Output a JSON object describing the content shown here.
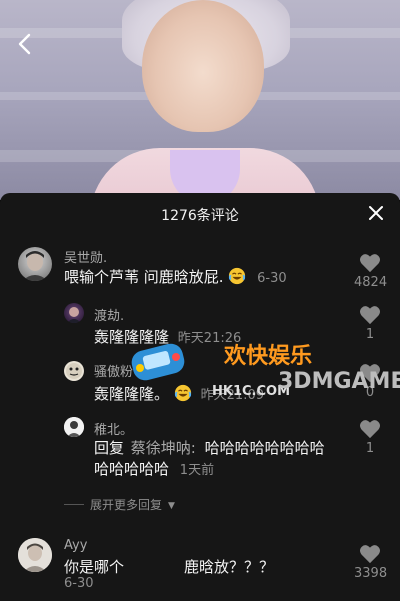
{
  "sheet": {
    "title": "1276条评论"
  },
  "comments": [
    {
      "user": "吴世勋.",
      "text": "喂输个芦苇 问鹿晗放屁.",
      "time": "6-30",
      "likes": "4824"
    },
    {
      "user": "渡劫.",
      "text": "轰隆隆隆隆",
      "time": "昨天21:26",
      "likes": "1"
    },
    {
      "user": "骚傲粉",
      "text": "轰隆隆隆。",
      "time": "昨天21:09",
      "likes": "0"
    },
    {
      "user": "稚北。",
      "reply_prefix": "回复",
      "reply_to": "蔡徐坤呐:",
      "text_line1": "哈哈哈哈哈哈哈哈",
      "text_line2": "哈哈哈哈哈",
      "time": "1天前",
      "likes": "1"
    },
    {
      "user": "Ayy",
      "text": "你是哪个",
      "text_tail": "鹿晗放",
      "text_end": "？？？",
      "time": "6-30",
      "likes": "3398"
    }
  ],
  "expand_label": "展开更多回复",
  "watermark": {
    "line1": "欢快娱乐",
    "line2": "HK1C.COM",
    "brand": "3DMGAME"
  },
  "colors": {
    "sheet_bg": "#161616",
    "muted": "#8e8e8e",
    "name": "#a9a9a9",
    "emoji": "#f6c531"
  }
}
